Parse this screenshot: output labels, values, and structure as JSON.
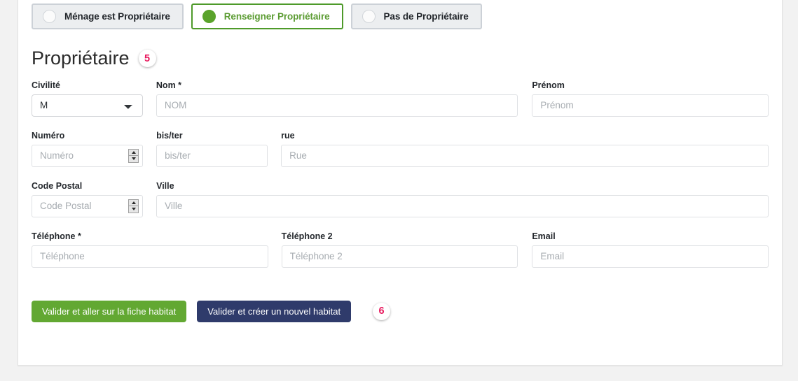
{
  "owner_mode": {
    "options": [
      {
        "label": "Ménage est Propriétaire",
        "selected": false,
        "icon": "radio-empty-icon"
      },
      {
        "label": "Renseigner Propriétaire",
        "selected": true,
        "icon": "radio-filled-icon"
      },
      {
        "label": "Pas de Propriétaire",
        "selected": false,
        "icon": "radio-empty-icon"
      }
    ]
  },
  "section": {
    "title": "Propriétaire",
    "step_badge": "5"
  },
  "form": {
    "civilite": {
      "label": "Civilité",
      "value": "M",
      "options": [
        "M"
      ],
      "dropdown_icon": "chevron-down-icon"
    },
    "nom": {
      "label": "Nom",
      "required_mark": "*",
      "placeholder": "NOM",
      "value": ""
    },
    "prenom": {
      "label": "Prénom",
      "placeholder": "Prénom",
      "value": ""
    },
    "numero": {
      "label": "Numéro",
      "placeholder": "Numéro",
      "value": "",
      "spinner_up_icon": "spinner-up-icon",
      "spinner_down_icon": "spinner-down-icon"
    },
    "bister": {
      "label": "bis/ter",
      "placeholder": "bis/ter",
      "value": ""
    },
    "rue": {
      "label": "rue",
      "placeholder": "Rue",
      "value": ""
    },
    "code_postal": {
      "label": "Code Postal",
      "placeholder": "Code Postal",
      "value": "",
      "spinner_up_icon": "spinner-up-icon",
      "spinner_down_icon": "spinner-down-icon"
    },
    "ville": {
      "label": "Ville",
      "placeholder": "Ville",
      "value": ""
    },
    "telephone": {
      "label": "Téléphone",
      "required_mark": "*",
      "placeholder": "Téléphone",
      "value": ""
    },
    "telephone2": {
      "label": "Téléphone 2",
      "placeholder": "Téléphone 2",
      "value": ""
    },
    "email": {
      "label": "Email",
      "placeholder": "Email",
      "value": ""
    }
  },
  "actions": {
    "primary_label": "Valider et aller sur la fiche habitat",
    "secondary_label": "Valider et créer un nouvel habitat",
    "step_badge": "6"
  },
  "colors": {
    "green": "#62a832",
    "green_border": "#4e9a2a",
    "navy": "#2f3b6b",
    "badge_pink": "#e8185d",
    "pill_bg": "#eceef0",
    "pill_border": "#ccd1d7",
    "page_bg": "#f2f2f2"
  }
}
